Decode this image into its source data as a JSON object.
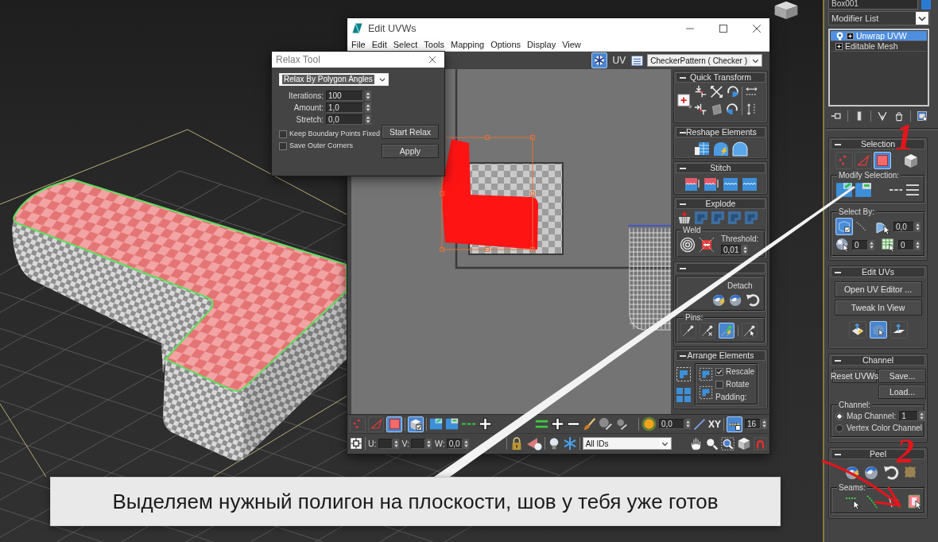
{
  "caption": "Выделяем нужный полигон на плоскости, шов у тебя уже готов",
  "annotations": [
    {
      "text": "1"
    },
    {
      "text": "2"
    }
  ],
  "relax_tool": {
    "title": "Relax Tool",
    "method": "Relax By Polygon Angles",
    "fields": [
      {
        "label": "Iterations:",
        "value": "100"
      },
      {
        "label": "Amount:",
        "value": "1,0"
      },
      {
        "label": "Stretch:",
        "value": "0,0"
      }
    ],
    "options": [
      {
        "label": "Keep Boundary Points Fixed",
        "checked": false
      },
      {
        "label": "Save Outer Corners",
        "checked": false
      }
    ],
    "buttons": [
      "Start Relax",
      "Apply"
    ]
  },
  "uv_editor": {
    "title": "Edit UVWs",
    "menu": [
      "File",
      "Edit",
      "Select",
      "Tools",
      "Mapping",
      "Options",
      "Display",
      "View"
    ],
    "toolbar": {
      "checker_toggle": {
        "selected": true
      },
      "uv_button": "UV",
      "texture": "CheckerPattern ( Checker )"
    },
    "rollouts": {
      "quick_transform": {
        "title": "Quick Transform"
      },
      "reshape_elements": {
        "title": "Reshape Elements"
      },
      "stitch": {
        "title": "Stitch"
      },
      "explode": {
        "title": "Explode",
        "weld_label": "Weld",
        "threshold_label": "Threshold:",
        "threshold": "0,01"
      },
      "peel": {
        "detach_label": "Detach",
        "pins_label": "Pins:",
        "pins": [
          {
            "selected": false
          },
          {
            "selected": false
          },
          {
            "selected": true
          },
          {
            "selected": false
          }
        ]
      },
      "arrange_elements": {
        "title": "Arrange Elements",
        "options": [
          {
            "label": "Rescale",
            "checked": true
          },
          {
            "label": "Rotate",
            "checked": false
          }
        ],
        "padding_label": "Padding:"
      }
    },
    "bottom_toolbar": {
      "modes": [
        {
          "kind": "vertex",
          "selected": false
        },
        {
          "kind": "edge",
          "selected": false
        },
        {
          "kind": "face",
          "selected": true
        }
      ],
      "element_toggle": {
        "selected": true
      },
      "falloff": "0,0",
      "axis": "XY",
      "brush_toggle": {
        "selected": true
      },
      "brush_size": "16",
      "coords": [
        {
          "label": "U:"
        },
        {
          "label": "V:"
        },
        {
          "label": "W:",
          "value": "0,0"
        }
      ],
      "id_filter": "All IDs"
    }
  },
  "command_panel": {
    "object_name": "Box001",
    "modifier_list": "Modifier List",
    "stack": [
      {
        "label": "Unwrap UVW",
        "kind": "modifier",
        "selected": true
      },
      {
        "label": "Editable Mesh",
        "kind": "base",
        "selected": false
      }
    ],
    "selection": {
      "title": "Selection",
      "modes": [
        {
          "kind": "vertex",
          "selected": false
        },
        {
          "kind": "edge",
          "selected": false
        },
        {
          "kind": "face",
          "selected": true
        }
      ],
      "modify_label": "Modify Selection:",
      "select_by_label": "Select By:",
      "select_by_toggle": {
        "selected": true
      },
      "angle": "0,0",
      "material_id": "0",
      "smoothing_group": "0"
    },
    "edit_uvs": {
      "title": "Edit UVs",
      "buttons": [
        "Open UV Editor ...",
        "Tweak In View"
      ],
      "tools": [
        {
          "selected": false
        },
        {
          "selected": true
        },
        {
          "selected": false
        }
      ]
    },
    "channel": {
      "title": "Channel",
      "buttons": [
        "Reset UVWs",
        "Save...",
        "Load..."
      ],
      "group_label": "Channel:",
      "options": [
        {
          "label": "Map Channel:",
          "selected": true,
          "value": "1"
        },
        {
          "label": "Vertex Color Channel",
          "selected": false
        }
      ]
    },
    "peel": {
      "title": "Peel",
      "seams_label": "Seams:"
    }
  }
}
